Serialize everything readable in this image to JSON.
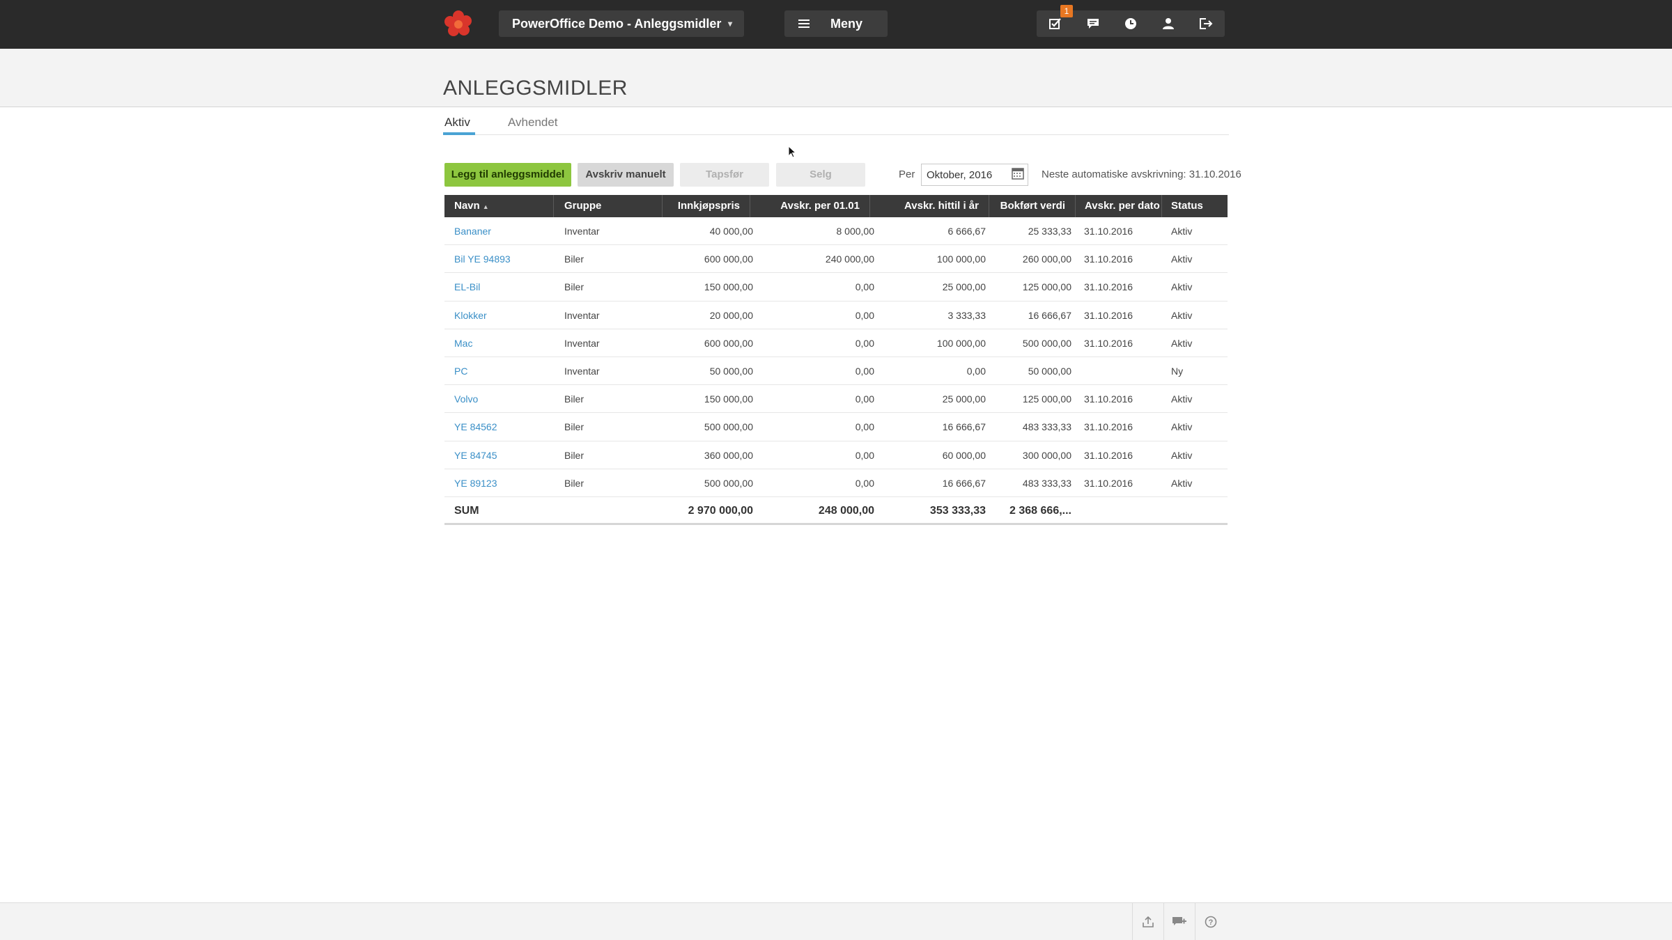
{
  "topbar": {
    "company_label": "PowerOffice Demo - Anleggsmidler",
    "menu_label": "Meny",
    "task_badge": "1",
    "icons": [
      "tasks-icon",
      "chat-icon",
      "clock-icon",
      "user-icon",
      "logout-icon"
    ]
  },
  "page": {
    "title": "ANLEGGSMIDLER"
  },
  "tabs": [
    {
      "label": "Aktiv",
      "active": true
    },
    {
      "label": "Avhendet",
      "active": false
    }
  ],
  "toolbar": {
    "add_label": "Legg til anleggsmiddel",
    "manual_label": "Avskriv manuelt",
    "loss_label": "Tapsfør",
    "sell_label": "Selg",
    "per_label": "Per",
    "date_value": "Oktober, 2016",
    "next_info": "Neste automatiske avskrivning: 31.10.2016"
  },
  "table": {
    "headers": [
      "Navn",
      "Gruppe",
      "Innkjøpspris",
      "Avskr. per 01.01",
      "Avskr. hittil i år",
      "Bokført verdi",
      "Avskr. per dato",
      "Status"
    ],
    "rows": [
      {
        "name": "Bananer",
        "group": "Inventar",
        "price": "40 000,00",
        "dep0101": "8 000,00",
        "depytd": "6 666,67",
        "book": "25 333,33",
        "depdate": "31.10.2016",
        "status": "Aktiv"
      },
      {
        "name": "Bil YE 94893",
        "group": "Biler",
        "price": "600 000,00",
        "dep0101": "240 000,00",
        "depytd": "100 000,00",
        "book": "260 000,00",
        "depdate": "31.10.2016",
        "status": "Aktiv"
      },
      {
        "name": "EL-Bil",
        "group": "Biler",
        "price": "150 000,00",
        "dep0101": "0,00",
        "depytd": "25 000,00",
        "book": "125 000,00",
        "depdate": "31.10.2016",
        "status": "Aktiv"
      },
      {
        "name": "Klokker",
        "group": "Inventar",
        "price": "20 000,00",
        "dep0101": "0,00",
        "depytd": "3 333,33",
        "book": "16 666,67",
        "depdate": "31.10.2016",
        "status": "Aktiv"
      },
      {
        "name": "Mac",
        "group": "Inventar",
        "price": "600 000,00",
        "dep0101": "0,00",
        "depytd": "100 000,00",
        "book": "500 000,00",
        "depdate": "31.10.2016",
        "status": "Aktiv"
      },
      {
        "name": "PC",
        "group": "Inventar",
        "price": "50 000,00",
        "dep0101": "0,00",
        "depytd": "0,00",
        "book": "50 000,00",
        "depdate": "",
        "status": "Ny"
      },
      {
        "name": "Volvo",
        "group": "Biler",
        "price": "150 000,00",
        "dep0101": "0,00",
        "depytd": "25 000,00",
        "book": "125 000,00",
        "depdate": "31.10.2016",
        "status": "Aktiv"
      },
      {
        "name": "YE 84562",
        "group": "Biler",
        "price": "500 000,00",
        "dep0101": "0,00",
        "depytd": "16 666,67",
        "book": "483 333,33",
        "depdate": "31.10.2016",
        "status": "Aktiv"
      },
      {
        "name": "YE 84745",
        "group": "Biler",
        "price": "360 000,00",
        "dep0101": "0,00",
        "depytd": "60 000,00",
        "book": "300 000,00",
        "depdate": "31.10.2016",
        "status": "Aktiv"
      },
      {
        "name": "YE 89123",
        "group": "Biler",
        "price": "500 000,00",
        "dep0101": "0,00",
        "depytd": "16 666,67",
        "book": "483 333,33",
        "depdate": "31.10.2016",
        "status": "Aktiv"
      }
    ],
    "sum": {
      "label": "SUM",
      "price": "2 970 000,00",
      "dep0101": "248 000,00",
      "depytd": "353 333,33",
      "book": "2 368 666,..."
    }
  },
  "footer": {
    "icons": [
      "export-icon",
      "feedback-icon",
      "help-icon"
    ]
  },
  "colors": {
    "topbar": "#2a2a2a",
    "accent_green": "#8dc63f",
    "link_blue": "#3a8fc7",
    "tab_underline": "#4aa3d4",
    "badge_orange": "#e87722"
  }
}
